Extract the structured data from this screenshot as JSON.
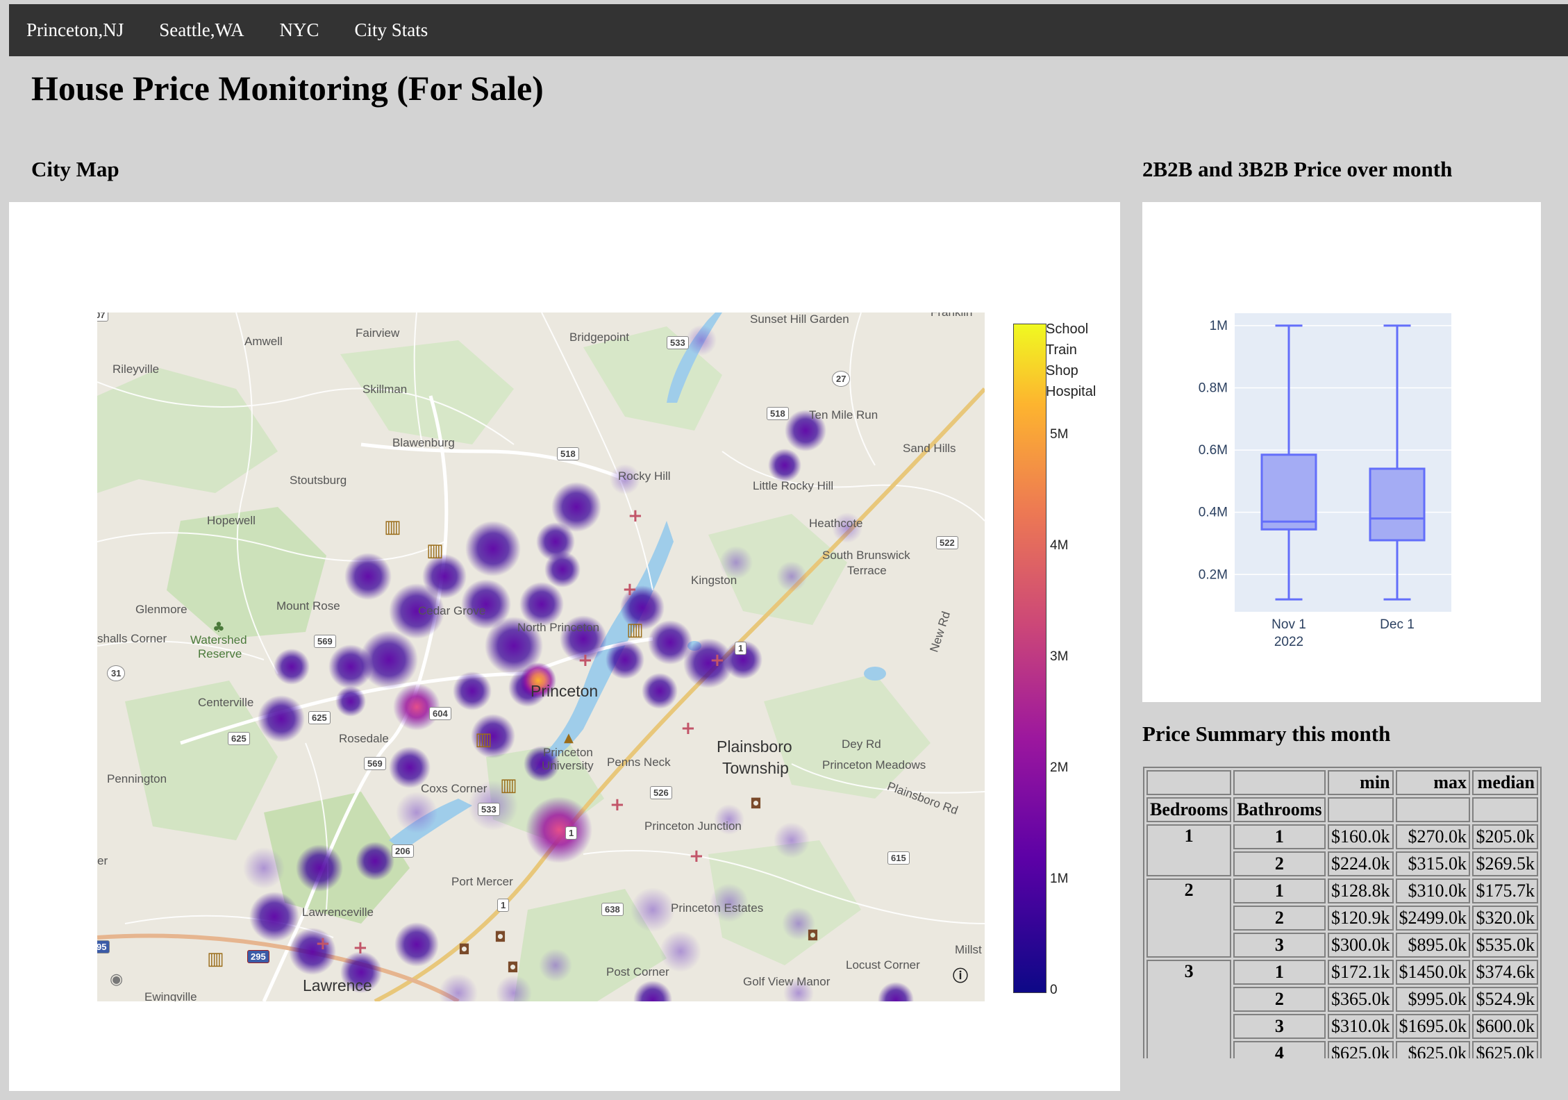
{
  "nav": {
    "items": [
      "Princeton,NJ",
      "Seattle,WA",
      "NYC",
      "City Stats"
    ]
  },
  "page_title": "House Price Monitoring (For Sale)",
  "map_section": {
    "title": "City Map",
    "colorbar": {
      "ticks": [
        "5M",
        "4M",
        "3M",
        "2M",
        "1M",
        "0"
      ],
      "legend": [
        "School",
        "Train",
        "Shop",
        "Hospital"
      ],
      "colors": [
        "#0d0887",
        "#5c01a6",
        "#9c179e",
        "#cc4778",
        "#ed7953",
        "#fdb42f",
        "#f0f921"
      ]
    },
    "places": {
      "amwell": "Amwell",
      "fairview": "Fairview",
      "bridgepoint": "Bridgepoint",
      "sunset_hill": "Sunset Hill Garden",
      "rileyville": "Rileyville",
      "skillman": "Skillman",
      "ten_mile_run": "Ten Mile Run",
      "sand_hills": "Sand Hills",
      "blawenburg": "Blawenburg",
      "rocky_hill": "Rocky Hill",
      "little_rocky_hill": "Little Rocky Hill",
      "stoutsburg": "Stoutsburg",
      "heathcote": "Heathcote",
      "hopewell": "Hopewell",
      "south_brunswick": "South Brunswick",
      "terrace": "Terrace",
      "kingston": "Kingston",
      "glenmore": "Glenmore",
      "mount_rose": "Mount Rose",
      "cedar_grove": "Cedar Grove",
      "north_princeton": "North Princeton",
      "shalls_corner": "shalls Corner",
      "watershed": "Watershed",
      "reserve": "Reserve",
      "princeton": "Princeton",
      "centerville": "Centerville",
      "rosedale": "Rosedale",
      "princeton_university_1": "Princeton",
      "princeton_university_2": "University",
      "penns_neck": "Penns Neck",
      "plainsboro": "Plainsboro",
      "township": "Township",
      "dey_rd": "Dey Rd",
      "princeton_meadows": "Princeton Meadows",
      "pennington": "Pennington",
      "coxs_corner": "Coxs Corner",
      "plainsboro_rd": "Plainsboro Rd",
      "princeton_junction": "Princeton Junction",
      "port_mercer": "Port Mercer",
      "lawrenceville": "Lawrenceville",
      "princeton_estates": "Princeton Estates",
      "millst": "Millst",
      "locust_corner": "Locust Corner",
      "post_corner": "Post Corner",
      "golf_view_manor": "Golf View Manor",
      "lawrence": "Lawrence",
      "ewingville": "Ewingville",
      "new_rd": "New Rd",
      "franklin": "Franklin",
      "er": "er"
    },
    "shields": {
      "s533a": "533",
      "s27": "27",
      "s518a": "518",
      "s518b": "518",
      "s522": "522",
      "s569a": "569",
      "s31": "31",
      "s1a": "1",
      "s625a": "625",
      "s604": "604",
      "s625b": "625",
      "s569b": "569",
      "s526": "526",
      "s533b": "533",
      "s1b": "1",
      "s206": "206",
      "s615": "615",
      "s638": "638",
      "s1c": "1",
      "s295": "295",
      "s95": "95",
      "s07": "07"
    }
  },
  "chart_section": {
    "title": "2B2B and 3B2B Price over month"
  },
  "chart_data": {
    "type": "box",
    "categories": [
      "Nov 1\n2022",
      "Dec 1"
    ],
    "x_tick_labels": [
      [
        "Nov 1",
        "2022"
      ],
      [
        "Dec 1"
      ]
    ],
    "series": [
      {
        "values": [
          {
            "min": 120000,
            "q1": 345000,
            "median": 370000,
            "q3": 585000,
            "max": 1000000
          },
          {
            "min": 120000,
            "q1": 310000,
            "median": 380000,
            "q3": 540000,
            "max": 1000000
          }
        ]
      }
    ],
    "y_ticks": [
      "0.2M",
      "0.4M",
      "0.6M",
      "0.8M",
      "1M"
    ],
    "y_tick_values": [
      200000,
      400000,
      600000,
      800000,
      1000000
    ],
    "ylim": [
      80000,
      1040000
    ],
    "colors": {
      "box_fill": "#a4acf4",
      "box_line": "#636efa",
      "plot_bg": "#e5ecf6"
    },
    "grid": true
  },
  "table_section": {
    "title": "Price Summary this month",
    "columns": [
      "min",
      "max",
      "median"
    ],
    "index_headers": [
      "Bedrooms",
      "Bathrooms"
    ],
    "groups": [
      {
        "bedrooms": "1",
        "rows": [
          {
            "bath": "1",
            "min": "$160.0k",
            "max": "$270.0k",
            "median": "$205.0k"
          },
          {
            "bath": "2",
            "min": "$224.0k",
            "max": "$315.0k",
            "median": "$269.5k"
          }
        ]
      },
      {
        "bedrooms": "2",
        "rows": [
          {
            "bath": "1",
            "min": "$128.8k",
            "max": "$310.0k",
            "median": "$175.7k"
          },
          {
            "bath": "2",
            "min": "$120.9k",
            "max": "$2499.0k",
            "median": "$320.0k"
          },
          {
            "bath": "3",
            "min": "$300.0k",
            "max": "$895.0k",
            "median": "$535.0k"
          }
        ]
      },
      {
        "bedrooms": "3",
        "rows": [
          {
            "bath": "1",
            "min": "$172.1k",
            "max": "$1450.0k",
            "median": "$374.6k"
          },
          {
            "bath": "2",
            "min": "$365.0k",
            "max": "$995.0k",
            "median": "$524.9k"
          },
          {
            "bath": "3",
            "min": "$310.0k",
            "max": "$1695.0k",
            "median": "$600.0k"
          },
          {
            "bath": "4",
            "min": "$625.0k",
            "max": "$625.0k",
            "median": "$625.0k"
          }
        ]
      }
    ]
  }
}
